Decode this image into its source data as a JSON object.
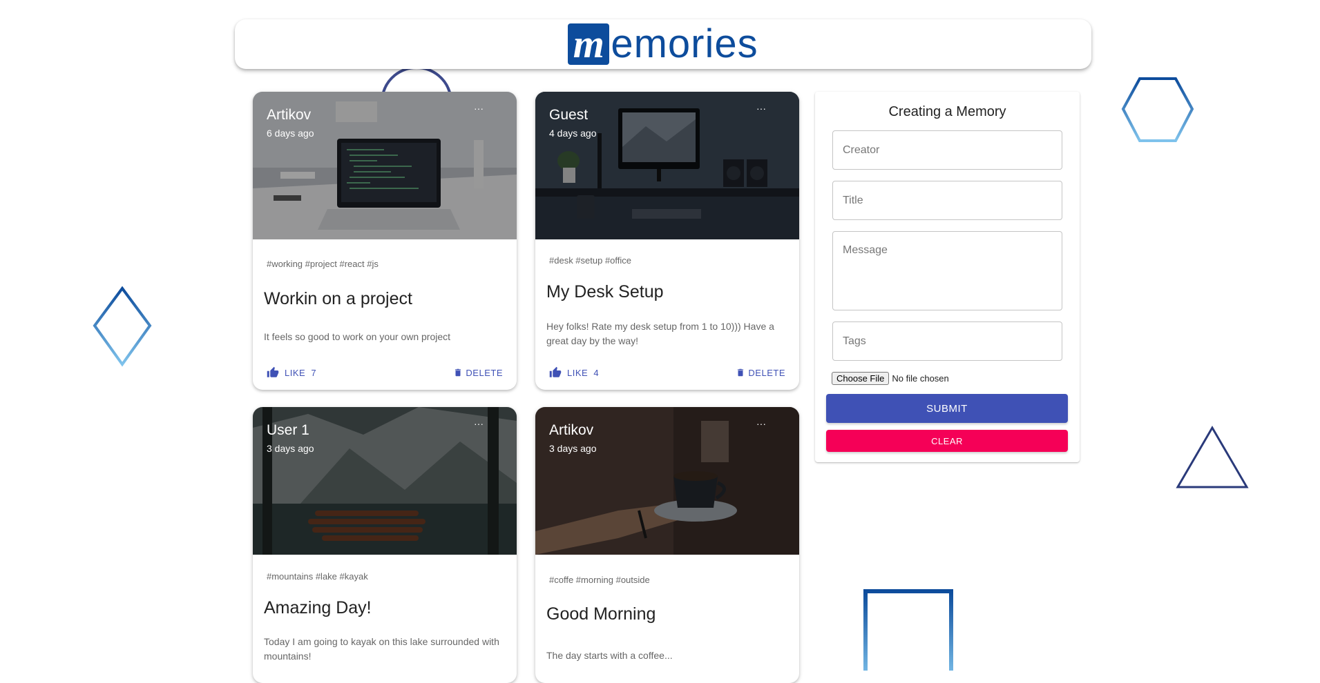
{
  "header": {
    "logo_letter": "m",
    "logo_text": "emories"
  },
  "posts": [
    {
      "creator": "Artikov",
      "time": "6 days ago",
      "tags": "#working #project #react #js",
      "title": "Workin on a project",
      "message": "It feels so good to work on your own project",
      "like_label": "LIKE",
      "like_count": "7",
      "delete_label": "DELETE",
      "more": "···",
      "image": "laptop-desk-photo"
    },
    {
      "creator": "Guest",
      "time": "4 days ago",
      "tags": "#desk #setup #office",
      "title": "My Desk Setup",
      "message": "Hey folks! Rate my desk setup from 1 to 10))) Have a great day by the way!",
      "like_label": "LIKE",
      "like_count": "4",
      "delete_label": "DELETE",
      "more": "···",
      "image": "desk-setup-photo"
    },
    {
      "creator": "User 1",
      "time": "3 days ago",
      "tags": "#mountains #lake #kayak",
      "title": "Amazing Day!",
      "message": "Today I am going to kayak on this lake surrounded with mountains!",
      "more": "···",
      "image": "mountain-lake-photo"
    },
    {
      "creator": "Artikov",
      "time": "3 days ago",
      "tags": "#coffe #morning #outside",
      "title": "Good Morning",
      "message": "The day starts with a coffee...",
      "more": "···",
      "image": "coffee-cup-photo"
    }
  ],
  "form": {
    "title": "Creating a Memory",
    "creator_placeholder": "Creator",
    "title_placeholder": "Title",
    "message_placeholder": "Message",
    "tags_placeholder": "Tags",
    "file_button": "Choose File",
    "file_status": "No file chosen",
    "submit_label": "SUBMIT",
    "clear_label": "CLEAR"
  },
  "colors": {
    "primary": "#3f51b5",
    "secondary": "#f50057",
    "brand": "#0d4c9c"
  },
  "icons": {
    "like": "thumb-up-icon",
    "delete": "trash-icon",
    "more": "more-horiz-icon"
  }
}
